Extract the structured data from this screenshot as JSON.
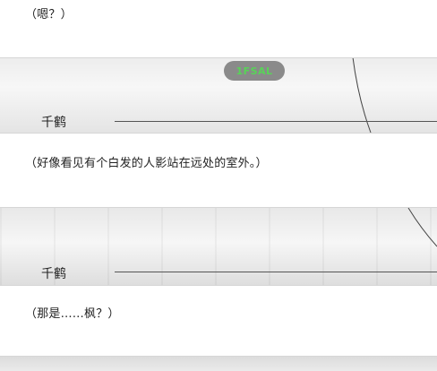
{
  "dialogue": [
    {
      "text": "（嗯？）"
    },
    {
      "speaker": "千鹤",
      "text": "（好像看见有个白发的人影站在远处的室外。）"
    },
    {
      "speaker": "千鹤",
      "text": "（那是……枫？）"
    }
  ],
  "badge": {
    "label": "1FSAL"
  },
  "colors": {
    "badge_bg": "#8a8a8a",
    "badge_text": "#58d358",
    "textbox": "#ffffff"
  }
}
